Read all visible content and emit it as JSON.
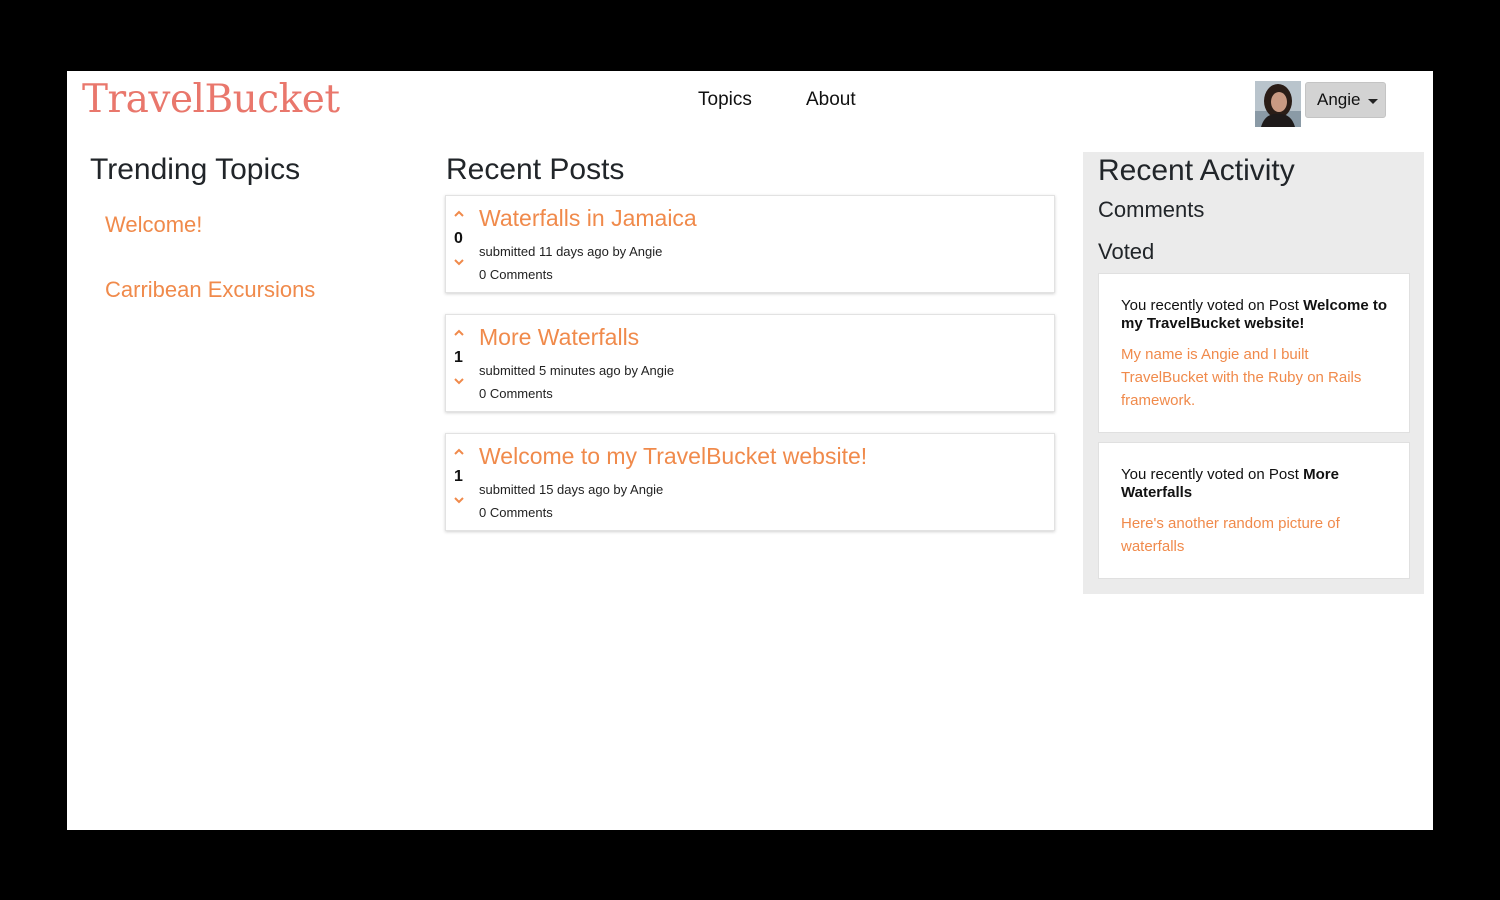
{
  "app": {
    "brand": "TravelBucket"
  },
  "nav": {
    "topics": "Topics",
    "about": "About"
  },
  "user": {
    "name": "Angie"
  },
  "trending": {
    "title": "Trending Topics",
    "topics": [
      "Welcome!",
      "Carribean Excursions"
    ]
  },
  "posts": {
    "title": "Recent Posts",
    "items": [
      {
        "title": "Waterfalls in Jamaica",
        "votes": "0",
        "meta": "submitted 11 days ago by Angie",
        "comments": "0 Comments"
      },
      {
        "title": "More Waterfalls",
        "votes": "1",
        "meta": "submitted 5 minutes ago by Angie",
        "comments": "0 Comments"
      },
      {
        "title": "Welcome to my TravelBucket website!",
        "votes": "1",
        "meta": "submitted 15 days ago by Angie",
        "comments": "0 Comments"
      }
    ]
  },
  "activity": {
    "title": "Recent Activity",
    "comments_label": "Comments",
    "voted_label": "Voted",
    "votes": [
      {
        "prefix": "You recently voted on Post ",
        "post": "Welcome to my TravelBucket website!",
        "body": "My name is Angie and I built TravelBucket with the Ruby on Rails framework."
      },
      {
        "prefix": "You recently voted on Post ",
        "post": "More Waterfalls",
        "body": "Here's another random picture of waterfalls"
      }
    ]
  },
  "colors": {
    "brand": "#e9776c",
    "accent": "#f08a4b",
    "activity_bg": "#ebebeb"
  },
  "icons": {
    "upvote": "chevron-up-icon",
    "downvote": "chevron-down-icon",
    "dropdown": "caret-down-icon"
  }
}
